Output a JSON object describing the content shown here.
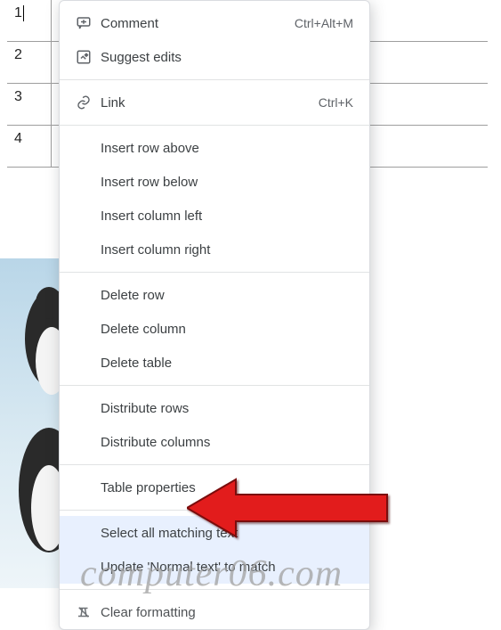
{
  "table_rows": [
    "1",
    "2",
    "3",
    "4"
  ],
  "menu": {
    "comment": {
      "label": "Comment",
      "shortcut": "Ctrl+Alt+M"
    },
    "suggest": {
      "label": "Suggest edits"
    },
    "link": {
      "label": "Link",
      "shortcut": "Ctrl+K"
    },
    "row_above": "Insert row above",
    "row_below": "Insert row below",
    "col_left": "Insert column left",
    "col_right": "Insert column right",
    "del_row": "Delete row",
    "del_col": "Delete column",
    "del_table": "Delete table",
    "dist_rows": "Distribute rows",
    "dist_cols": "Distribute columns",
    "table_props": "Table properties",
    "sel_match": "Select all matching text",
    "upd_normal": "Update 'Normal text' to match",
    "clear_fmt": "Clear formatting"
  },
  "watermark": "computer06.com"
}
